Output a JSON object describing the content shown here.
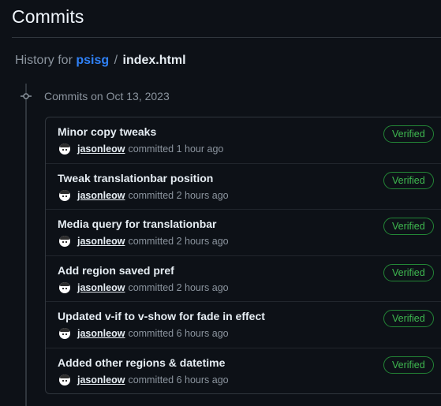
{
  "header": {
    "title": "Commits"
  },
  "breadcrumb": {
    "prefix": "History for",
    "repo": "psisg",
    "separator": "/",
    "file": "index.html"
  },
  "group": {
    "heading": "Commits on Oct 13, 2023"
  },
  "commits": [
    {
      "title": "Minor copy tweaks",
      "author": "jasonleow",
      "action": "committed",
      "time": "1 hour ago",
      "badge": "Verified"
    },
    {
      "title": "Tweak translationbar position",
      "author": "jasonleow",
      "action": "committed",
      "time": "2 hours ago",
      "badge": "Verified"
    },
    {
      "title": "Media query for translationbar",
      "author": "jasonleow",
      "action": "committed",
      "time": "2 hours ago",
      "badge": "Verified"
    },
    {
      "title": "Add region saved pref",
      "author": "jasonleow",
      "action": "committed",
      "time": "2 hours ago",
      "badge": "Verified"
    },
    {
      "title": "Updated v-if to v-show for fade in effect",
      "author": "jasonleow",
      "action": "committed",
      "time": "6 hours ago",
      "badge": "Verified"
    },
    {
      "title": "Added other regions & datetime",
      "author": "jasonleow",
      "action": "committed",
      "time": "6 hours ago",
      "badge": "Verified"
    }
  ],
  "colors": {
    "background": "#0d1117",
    "link": "#2f81f7",
    "verified": "#3fb950",
    "border": "#30363d"
  },
  "icons": {
    "timeline": "git-commit-icon",
    "avatar": "user-avatar"
  }
}
